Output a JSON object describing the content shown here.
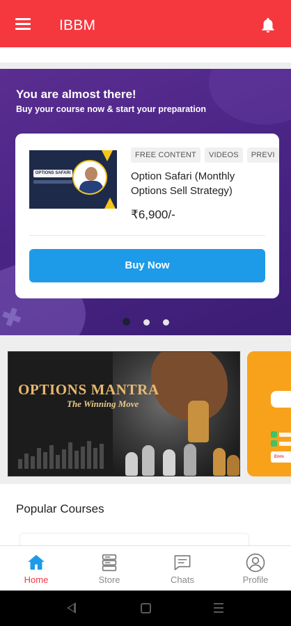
{
  "app_bar": {
    "title": "IBBM",
    "menu_icon": "hamburger-menu-icon",
    "notification_icon": "bell-icon",
    "background": "#f5373e"
  },
  "promo": {
    "heading": "You are almost there!",
    "subheading": "Buy your course now & start your preparation",
    "background": "#4a2586",
    "card": {
      "thumbnail_tag": "OPTIONS SAFARI",
      "chips": [
        "FREE CONTENT",
        "VIDEOS",
        "PREVI"
      ],
      "title": "Option Safari (Monthly Options Sell Strategy)",
      "price": "₹6,900/-",
      "buy_button": "Buy Now",
      "button_color": "#1e9be8"
    },
    "carousel": {
      "count": 3,
      "active_index": 0
    }
  },
  "banners": [
    {
      "heading": "OPTIONS MANTRA",
      "tagline": "The Winning Move"
    },
    {
      "button": "Enro"
    }
  ],
  "popular": {
    "heading": "Popular Courses"
  },
  "bottom_nav": {
    "items": [
      {
        "label": "Home",
        "icon": "home-icon",
        "active": true
      },
      {
        "label": "Store",
        "icon": "store-icon",
        "active": false
      },
      {
        "label": "Chats",
        "icon": "chat-icon",
        "active": false
      },
      {
        "label": "Profile",
        "icon": "profile-icon",
        "active": false
      }
    ],
    "active_color": "#f5373e"
  }
}
